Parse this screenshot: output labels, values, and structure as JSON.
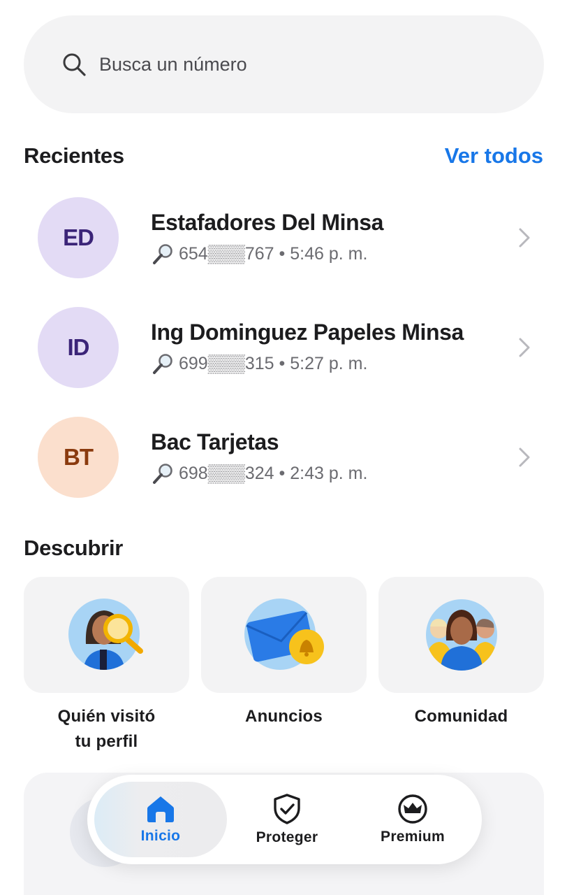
{
  "search": {
    "placeholder": "Busca un número"
  },
  "recents": {
    "title": "Recientes",
    "see_all": "Ver todos",
    "items": [
      {
        "initials": "ED",
        "name": "Estafadores Del Minsa",
        "number": "654▒▒▒767",
        "time": "5:46 p. m.",
        "avatar_bg": "#e3dbf5",
        "avatar_fg": "#3b2478"
      },
      {
        "initials": "ID",
        "name": "Ing Dominguez Papeles Minsa",
        "number": "699▒▒▒315",
        "time": "5:27 p. m.",
        "avatar_bg": "#e3dbf5",
        "avatar_fg": "#3b2478"
      },
      {
        "initials": "BT",
        "name": "Bac Tarjetas",
        "number": "698▒▒▒324",
        "time": "2:43 p. m.",
        "avatar_bg": "#fbdfcd",
        "avatar_fg": "#8a3a0e"
      }
    ]
  },
  "discover": {
    "title": "Descubrir",
    "cards": [
      {
        "label_line1": "Quién visitó",
        "label_line2": "tu perfil"
      },
      {
        "label_line1": "Anuncios",
        "label_line2": ""
      },
      {
        "label_line1": "Comunidad",
        "label_line2": ""
      }
    ]
  },
  "tabbar": {
    "tabs": [
      {
        "label": "Inicio",
        "icon": "home-icon",
        "active": true
      },
      {
        "label": "Proteger",
        "icon": "shield-check-icon",
        "active": false
      },
      {
        "label": "Premium",
        "icon": "crown-icon",
        "active": false
      }
    ]
  },
  "colors": {
    "accent": "#1877e8",
    "text": "#1c1c1e",
    "secondary": "#6b6b70",
    "surface": "#f3f3f4"
  }
}
